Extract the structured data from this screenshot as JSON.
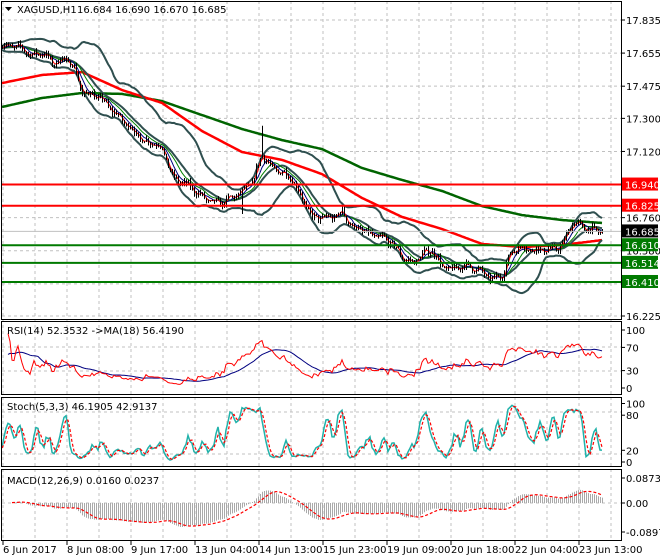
{
  "header": {
    "symbol": "XAGUSD,H1",
    "ohlc": "16.684 16.690 16.670 16.685"
  },
  "colors": {
    "resistance": "#ff0000",
    "support": "#007a00",
    "bid_box": "#000000",
    "ma_slow_red": "#ff0000",
    "ma_slow_green": "#006400",
    "bollinger": "#2f4f4f",
    "stoch_main": "#20b2aa",
    "stoch_signal": "#ff0000",
    "rsi_line": "#ff0000",
    "rsi_ma": "#000080",
    "macd_hist": "#a9a9a9"
  },
  "chart_data": {
    "type": "candlestick",
    "price_axis": {
      "ticks": [
        "17.835",
        "17.655",
        "17.475",
        "17.300",
        "17.120",
        "16.760",
        "16.580",
        "16.225"
      ],
      "range": [
        16.225,
        17.835
      ]
    },
    "time_axis": {
      "ticks": [
        "6 Jun 2017",
        "8 Jun 08:00",
        "9 Jun 17:00",
        "13 Jun 04:00",
        "14 Jun 13:00",
        "15 Jun 23:00",
        "19 Jun 09:00",
        "20 Jun 18:00",
        "22 Jun 04:00",
        "23 Jun 13:00"
      ]
    },
    "close_samples": [
      17.7,
      17.69,
      17.68,
      17.64,
      17.66,
      17.6,
      17.62,
      17.6,
      17.44,
      17.43,
      17.4,
      17.34,
      17.29,
      17.24,
      17.18,
      17.17,
      17.14,
      16.98,
      16.95,
      16.92,
      16.87,
      16.84,
      16.84,
      16.87,
      16.9,
      16.95,
      17.11,
      17.02,
      17.01,
      16.97,
      16.86,
      16.76,
      16.76,
      16.76,
      16.79,
      16.71,
      16.69,
      16.66,
      16.65,
      16.62,
      16.545,
      16.51,
      16.56,
      16.585,
      16.49,
      16.475,
      16.5,
      16.49,
      16.46,
      16.42,
      16.45,
      16.585,
      16.6,
      16.585,
      16.585,
      16.585,
      16.61,
      16.735,
      16.71,
      16.69,
      16.685
    ],
    "ma_red_samples": [
      17.492,
      17.536,
      17.552,
      17.454,
      17.384,
      17.231,
      17.117,
      17.074,
      16.997,
      16.867,
      16.764,
      16.698,
      16.617,
      16.6,
      16.611,
      16.638
    ],
    "ma_green_samples": [
      17.362,
      17.411,
      17.438,
      17.433,
      17.394,
      17.318,
      17.242,
      17.182,
      17.133,
      17.03,
      16.965,
      16.905,
      16.823,
      16.774,
      16.747,
      16.731
    ],
    "levels": [
      {
        "price": 16.94,
        "label": "16.940",
        "kind": "resistance"
      },
      {
        "price": 16.825,
        "label": "16.825",
        "kind": "resistance"
      },
      {
        "price": 16.61,
        "label": "16.610",
        "kind": "support"
      },
      {
        "price": 16.514,
        "label": "16.514",
        "kind": "support"
      },
      {
        "price": 16.41,
        "label": "16.410",
        "kind": "support"
      }
    ],
    "bid": {
      "price": 16.685,
      "label": "16.685"
    },
    "rsi": {
      "title": "RSI(14) 52.3532  ->MA(18) 56.4190",
      "ticks": [
        "100",
        "70",
        "30",
        "0"
      ]
    },
    "stoch": {
      "title": "Stoch(5,3,3) 46.1905 42.9137",
      "ticks": [
        "100",
        "80",
        "20",
        "0"
      ]
    },
    "macd": {
      "title": "MACD(12,26,9) 0.0160 0.0237",
      "ticks": [
        "0.0873",
        "0.00",
        "-0.0897"
      ],
      "range": [
        -0.0897,
        0.0873
      ]
    }
  }
}
